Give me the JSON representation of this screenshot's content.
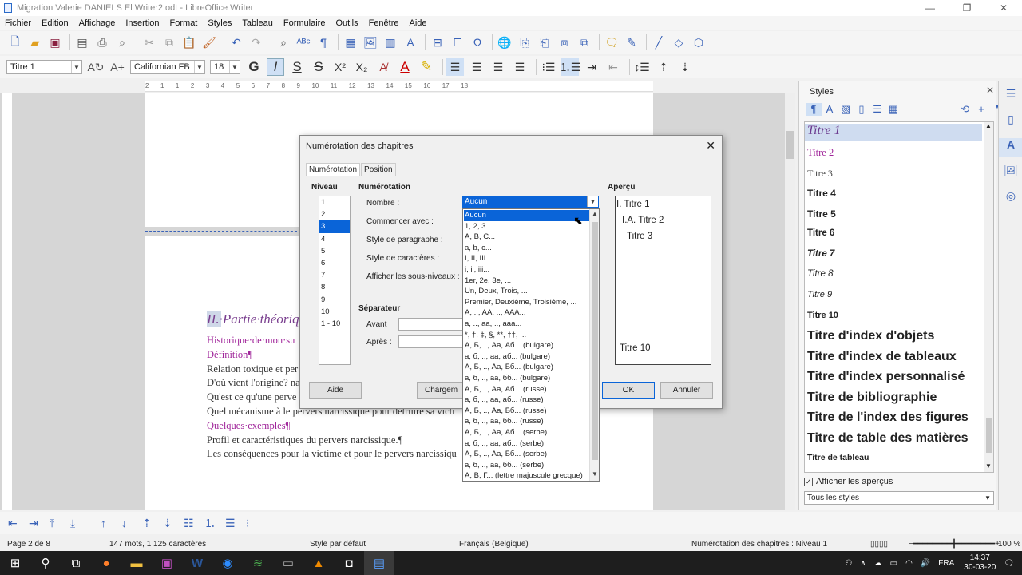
{
  "window": {
    "title": "Migration Valerie DANIELS El Writer2.odt - LibreOffice Writer",
    "controls": [
      "—",
      "❐",
      "✕"
    ]
  },
  "menu": [
    "Fichier",
    "Edition",
    "Affichage",
    "Insertion",
    "Format",
    "Styles",
    "Tableau",
    "Formulaire",
    "Outils",
    "Fenêtre",
    "Aide"
  ],
  "toolbar": {
    "paragraph_style": "Titre 1",
    "font_name": "Californian FB",
    "font_size": "18"
  },
  "ruler": [
    "2",
    "1",
    "1",
    "2",
    "3",
    "4",
    "5",
    "6",
    "7",
    "8",
    "9",
    "10",
    "11",
    "12",
    "13",
    "14",
    "15",
    "16",
    "17",
    "18"
  ],
  "document": {
    "heading": "II.·Partie·théoriqu",
    "lines": [
      {
        "text": "Historique·de·mon·su",
        "style": "mag"
      },
      {
        "text": "Définition¶",
        "style": "mag"
      },
      {
        "text": "Relation toxique et per",
        "style": "normal"
      },
      {
        "text": "D'où vient l'origine? na",
        "style": "normal"
      },
      {
        "text": "Qu'est ce qu'une perve",
        "style": "normal"
      },
      {
        "text": "Quel mécanisme à le pervers narcissique pour détruire sa victi",
        "style": "normal"
      },
      {
        "text": "Quelques·exemples¶",
        "style": "mag"
      },
      {
        "text": "Profil et caractéristiques du pervers narcissique.¶",
        "style": "normal"
      },
      {
        "text": "Les conséquences pour la victime et pour le pervers narcissiqu",
        "style": "normal"
      }
    ]
  },
  "sidebar": {
    "title": "Styles",
    "close": "✕",
    "styles": [
      "Titre 1",
      "Titre 2",
      "Titre 3",
      "Titre 4",
      "Titre 5",
      "Titre 6",
      "Titre 7",
      "Titre 8",
      "Titre 9",
      "Titre 10",
      "Titre d'index d'objets",
      "Titre d'index de tableaux",
      "Titre d'index personnalisé",
      "Titre de bibliographie",
      "Titre de l'index des figures",
      "Titre de table des matières",
      "Titre de tableau"
    ],
    "show_previews": "Afficher les aperçus",
    "filter": "Tous les styles"
  },
  "dialog": {
    "title": "Numérotation des chapitres",
    "close": "✕",
    "tabs": [
      "Numérotation",
      "Position"
    ],
    "niveau_label": "Niveau",
    "levels": [
      "1",
      "2",
      "3",
      "4",
      "5",
      "6",
      "7",
      "8",
      "9",
      "10",
      "1 - 10"
    ],
    "selected_level": "3",
    "numerotation_label": "Numérotation",
    "fields": {
      "nombre": "Nombre :",
      "commencer": "Commencer avec :",
      "style_para": "Style de paragraphe :",
      "style_car": "Style de caractères :",
      "sous_niveaux": "Afficher les sous-niveaux :"
    },
    "separateur_label": "Séparateur",
    "avant": "Avant :",
    "apres": "Après :",
    "apercu_label": "Aperçu",
    "preview": [
      "I. Titre 1",
      "I.A. Titre 2",
      "Titre 3",
      "Titre 10"
    ],
    "buttons": {
      "aide": "Aide",
      "chargement": "Chargem",
      "ok": "OK",
      "annuler": "Annuler"
    }
  },
  "dropdown": {
    "value": "Aucun",
    "options": [
      "Aucun",
      "1, 2, 3...",
      "A, B, C...",
      "a, b, c...",
      "I, II, III...",
      "i, ii, iii...",
      "1er, 2e, 3e, ...",
      "Un, Deux, Trois, ...",
      "Premier, Deuxième, Troisième, ...",
      "A, .., AA, .., AAA...",
      "a, .., aa, .., aaa...",
      "*, †, ‡, §, **, ††, ...",
      "А, Б, .., Аа, Аб... (bulgare)",
      "а, б, .., аа, аб... (bulgare)",
      "А, Б, .., Аа, Бб... (bulgare)",
      "а, б, .., аа, бб... (bulgare)",
      "А, Б, .., Аа, Аб... (russe)",
      "а, б, .., аа, аб... (russe)",
      "А, Б, .., Аа, Бб... (russe)",
      "а, б, .., аа, бб... (russe)",
      "А, Б, .., Аа, Аб... (serbe)",
      "а, б, .., аа, аб... (serbe)",
      "А, Б, .., Аа, Бб... (serbe)",
      "а, б, .., аа, бб... (serbe)",
      "Α, Β, Γ... (lettre majuscule grecque)"
    ]
  },
  "status": {
    "page": "Page 2 de 8",
    "words": "147 mots, 1 125 caractères",
    "style": "Style par défaut",
    "lang": "Français (Belgique)",
    "outline": "Numérotation des chapitres : Niveau 1",
    "zoom": "100 %"
  },
  "tray": {
    "lang": "FRA",
    "time": "14:37",
    "date": "30-03-20"
  }
}
